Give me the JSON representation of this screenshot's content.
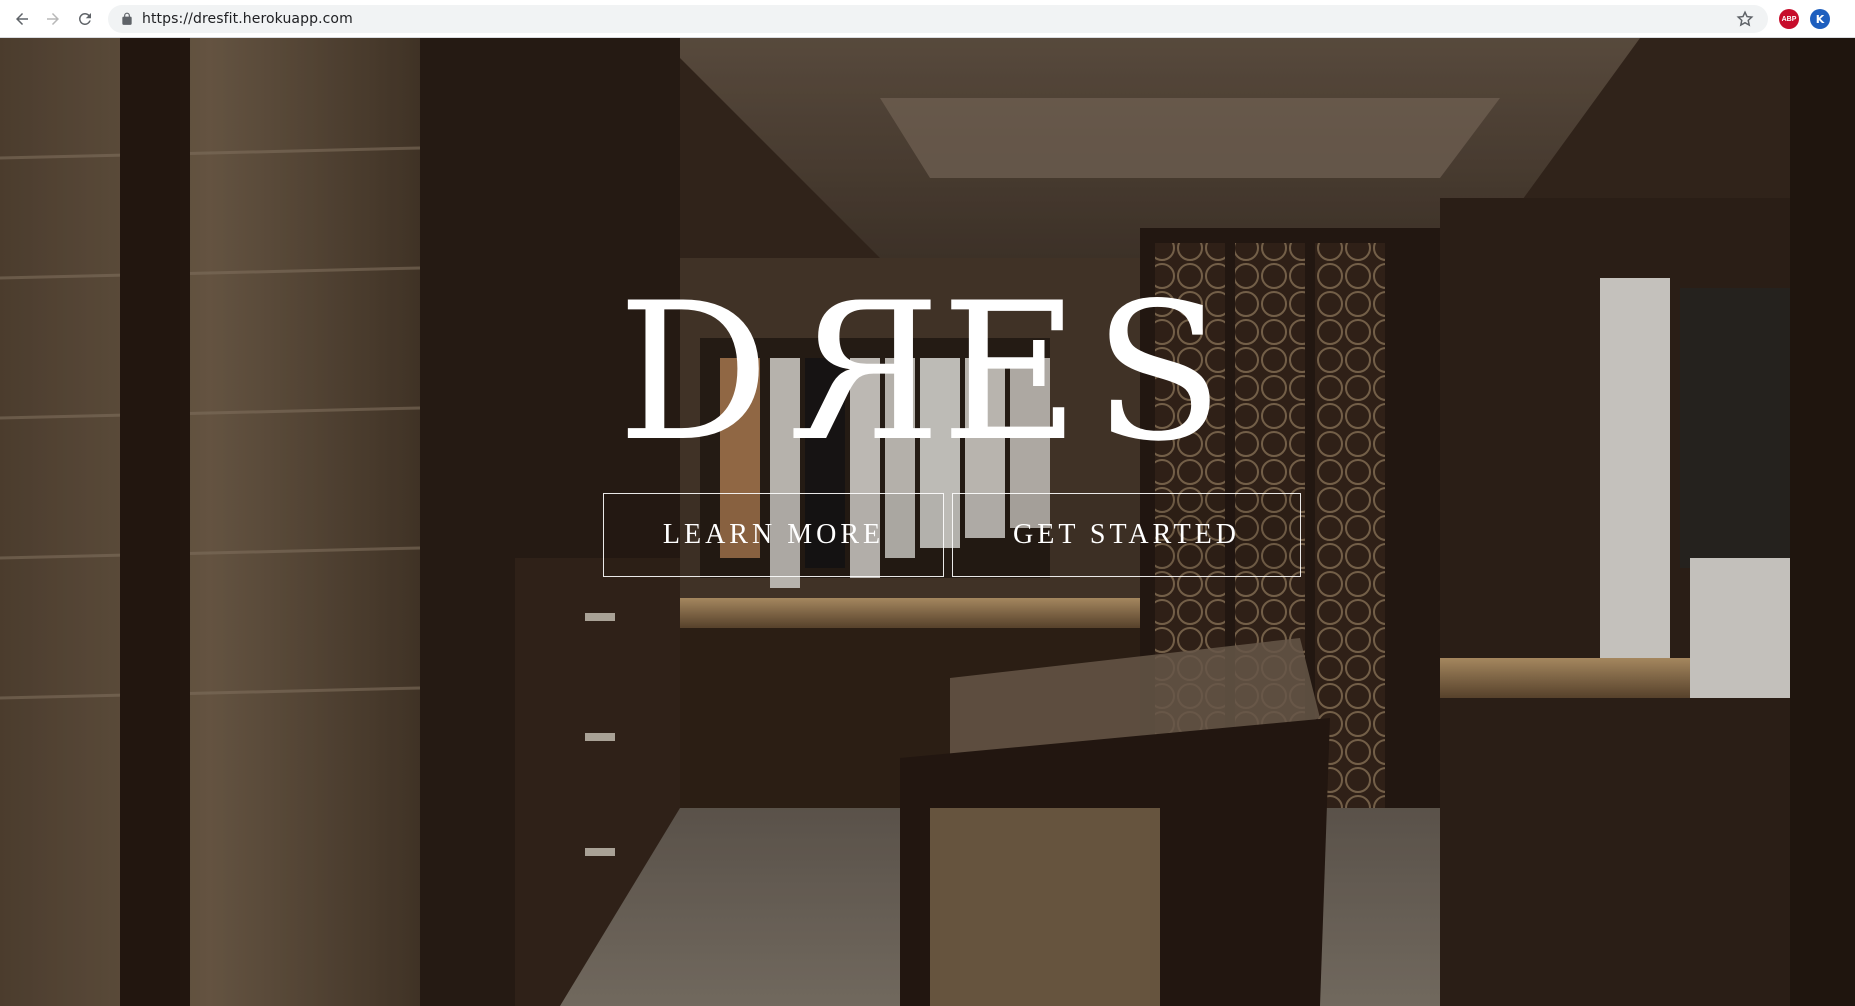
{
  "browser": {
    "url": "https://dresfit.herokuapp.com",
    "extensions": {
      "abp": "ABP",
      "k": "K"
    }
  },
  "hero": {
    "logo": {
      "first": "D",
      "reversed": "R",
      "rest": "ES"
    },
    "buttons": {
      "learn_more": "LEARN MORE",
      "get_started": "GET STARTED"
    }
  }
}
